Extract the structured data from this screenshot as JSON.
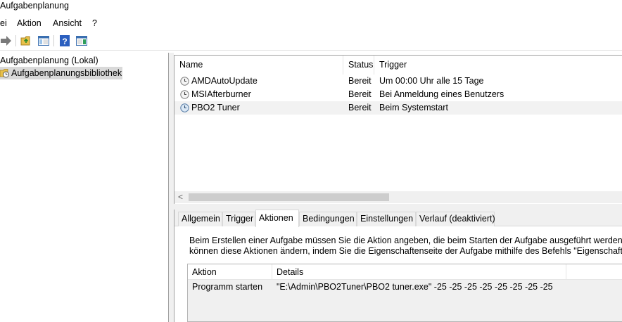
{
  "window": {
    "title": "Aufgabenplanung"
  },
  "menu": {
    "items": [
      "ei",
      "Aktion",
      "Ansicht",
      "?"
    ]
  },
  "toolbar": {
    "icons": [
      "forward-arrow-icon",
      "folder-up-icon",
      "console-tree-icon",
      "help-icon",
      "action-pane-icon"
    ]
  },
  "tree": {
    "root": "Aufgabenplanung (Lokal)",
    "library": "Aufgabenplanungsbibliothek"
  },
  "task_list": {
    "columns": [
      "Name",
      "Status",
      "Trigger"
    ],
    "rows": [
      {
        "name": "AMDAutoUpdate",
        "status": "Bereit",
        "trigger": "Um 00:00 Uhr alle 15 Tage"
      },
      {
        "name": "MSIAfterburner",
        "status": "Bereit",
        "trigger": "Bei Anmeldung eines Benutzers"
      },
      {
        "name": "PBO2 Tuner",
        "status": "Bereit",
        "trigger": "Beim Systemstart"
      }
    ],
    "selected_row": "PBO2 Tuner"
  },
  "tabs": {
    "items": [
      "Allgemein",
      "Trigger",
      "Aktionen",
      "Bedingungen",
      "Einstellungen",
      "Verlauf (deaktiviert)"
    ],
    "active": "Aktionen"
  },
  "actions_panel": {
    "description_line1": "Beim Erstellen einer Aufgabe müssen Sie die Aktion angeben, die beim Starten der Aufgabe ausgeführt werden soll. Si",
    "description_line2": "können diese Aktionen ändern, indem Sie die Eigenschaftenseite der Aufgabe mithilfe des Befehls \"Eigenschaften\"",
    "columns": [
      "Aktion",
      "Details"
    ],
    "rows": [
      {
        "action": "Programm starten",
        "details": "\"E:\\Admin\\PBO2Tuner\\PBO2 tuner.exe\" -25 -25 -25 -25 -25 -25 -25 -25"
      }
    ]
  },
  "colors": {
    "selection": "#d9d9d9",
    "row_highlight": "#f2f2f2",
    "chrome": "#f0f0f0"
  }
}
